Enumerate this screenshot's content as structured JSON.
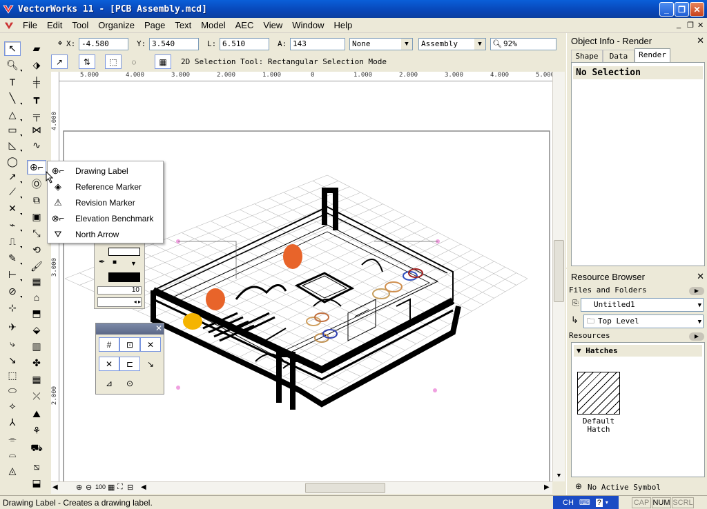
{
  "window": {
    "title": "VectorWorks 11 - [PCB Assembly.mcd]",
    "minimize": "_",
    "restore": "❐",
    "close": "✕"
  },
  "menu": [
    {
      "label": "File"
    },
    {
      "label": "Edit"
    },
    {
      "label": "Tool"
    },
    {
      "label": "Organize"
    },
    {
      "label": "Page"
    },
    {
      "label": "Text"
    },
    {
      "label": "Model"
    },
    {
      "label": "AEC"
    },
    {
      "label": "View"
    },
    {
      "label": "Window"
    },
    {
      "label": "Help"
    }
  ],
  "mdi_controls": {
    "minimize": "_",
    "restore": "❐",
    "close": "✕"
  },
  "databar": {
    "x_label": "X:",
    "x_value": "-4.580",
    "y_label": "Y:",
    "y_value": "3.540",
    "l_label": "L:",
    "l_value": "6.510",
    "a_label": "A:",
    "a_value": "143",
    "class_value": "None",
    "layer_value": "Assembly",
    "zoom_value": "92%"
  },
  "modebar": {
    "mode_text": "2D Selection Tool: Rectangular Selection Mode"
  },
  "ruler": {
    "h_ticks": [
      "5.000",
      "4.000",
      "3.000",
      "2.000",
      "1.000",
      "0",
      "1.000",
      "2.000",
      "3.000",
      "4.000",
      "5.000"
    ],
    "v_ticks": [
      "4.000",
      "3.000",
      "2.000"
    ]
  },
  "flyout_menu": {
    "items": [
      {
        "label": "Drawing Label",
        "icon": "drawing-label-icon"
      },
      {
        "label": "Reference Marker",
        "icon": "reference-marker-icon"
      },
      {
        "label": "Revision Marker",
        "icon": "revision-marker-icon"
      },
      {
        "label": "Elevation Benchmark",
        "icon": "elevation-benchmark-icon"
      },
      {
        "label": "North Arrow",
        "icon": "north-arrow-icon"
      }
    ]
  },
  "attributes_palette": {
    "line_weight": "10"
  },
  "object_info": {
    "title": "Object Info - Render",
    "tabs": [
      {
        "label": "Shape"
      },
      {
        "label": "Data"
      },
      {
        "label": "Render"
      }
    ],
    "selection": "No Selection"
  },
  "resource_browser": {
    "title": "Resource Browser",
    "files_label": "Files and Folders",
    "file_value": "Untitled1",
    "folder_value": "Top Level",
    "resources_label": "Resources",
    "group_label": "Hatches",
    "item_label": "Default Hatch",
    "symbol_status": "No Active Symbol"
  },
  "statusbar": {
    "text": "Drawing Label - Creates a drawing label.",
    "ime": "CH",
    "caps": "CAP",
    "num": "NUM",
    "scrl": "SCRL"
  },
  "colors": {
    "titlebar": "#0a5fd8",
    "accent_orange": "#e8642a",
    "accent_yellow": "#f5b400"
  }
}
